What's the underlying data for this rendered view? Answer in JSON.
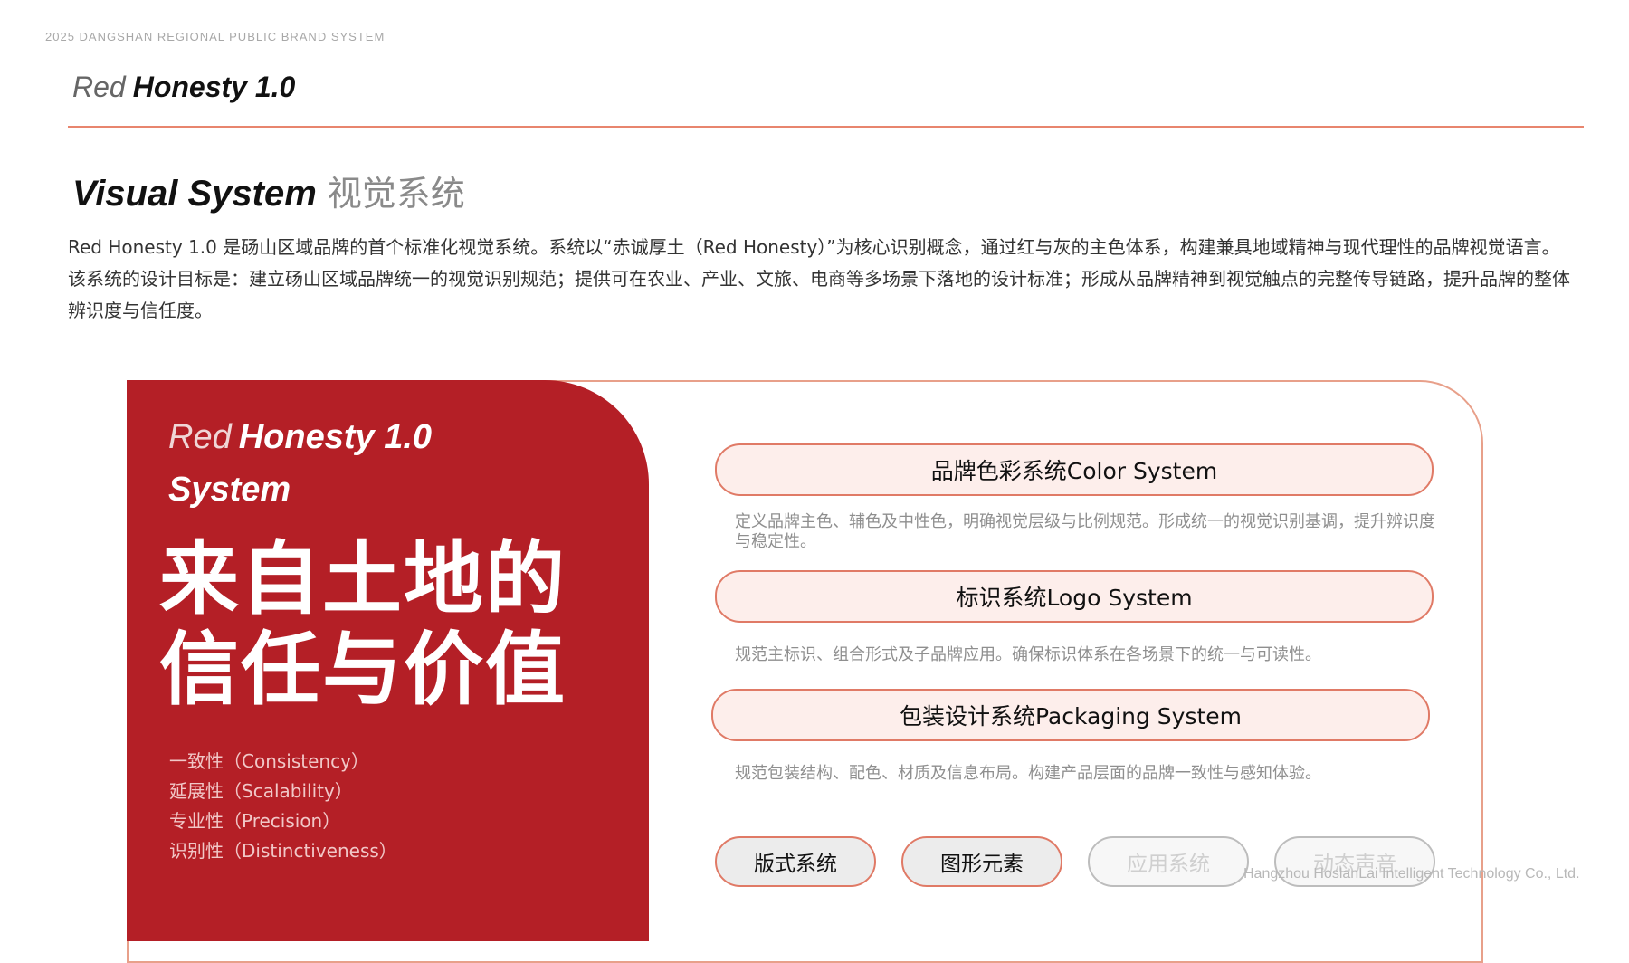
{
  "header": {
    "small_caption": "2025 DANGSHAN REGIONAL PUBLIC BRAND SYSTEM",
    "brand_thin": "Red",
    "brand_bold": "Honesty 1.0"
  },
  "section": {
    "title_en": "Visual System",
    "title_cn": "视觉系统",
    "intro": "Red Honesty 1.0 是砀山区域品牌的首个标准化视觉系统。系统以“赤诚厚土（Red Honesty）”为核心识别概念，通过红与灰的主色体系，构建兼具地域精神与现代理性的品牌视觉语言。该系统的设计目标是：建立砀山区域品牌统一的视觉识别规范；提供可在农业、产业、文旅、电商等多场景下落地的设计标准；形成从品牌精神到视觉触点的完整传导链路，提升品牌的整体辨识度与信任度。"
  },
  "panel": {
    "title_thin": "Red",
    "title_bold": "Honesty 1.0",
    "subtitle": "System",
    "slogan_line1": "来自土地的",
    "slogan_line2": "信任与价值",
    "principles": [
      "一致性（Consistency）",
      "延展性（Scalability）",
      "专业性（Precision）",
      "识别性（Distinctiveness）"
    ]
  },
  "systems": [
    {
      "label": "品牌色彩系统Color System",
      "desc": "定义品牌主色、辅色及中性色，明确视觉层级与比例规范。形成统一的视觉识别基调，提升辨识度与稳定性。"
    },
    {
      "label": "标识系统Logo System",
      "desc": "规范主标识、组合形式及子品牌应用。确保标识体系在各场景下的统一与可读性。"
    },
    {
      "label": "包装设计系统Packaging System",
      "desc": "规范包装结构、配色、材质及信息布局。构建产品层面的品牌一致性与感知体验。"
    }
  ],
  "tags": [
    "版式系统",
    "图形元素",
    "应用系统",
    "动态声音"
  ],
  "footer": "Hangzhou HoslanLai Intelligent Technology Co., Ltd.",
  "colors": {
    "accent": "#e8856e",
    "brand_red": "#b41f26",
    "pill_fill": "#fdeeeb"
  }
}
